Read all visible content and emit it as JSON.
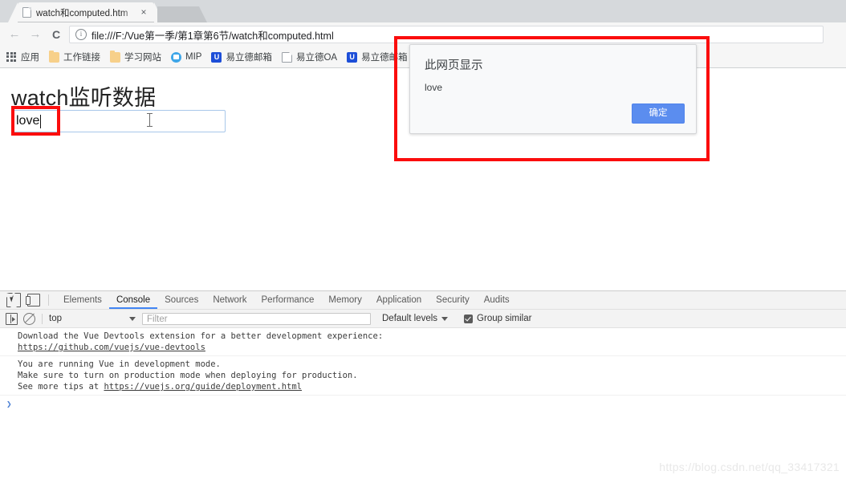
{
  "browser": {
    "tab": {
      "title": "watch和computed.htm",
      "close_label": "×",
      "favicon": "page-icon"
    },
    "nav": {
      "back": "←",
      "forward": "→",
      "reload": "C"
    },
    "omnibox": {
      "info_icon": "ⓘ",
      "url": "file:///F:/Vue第一季/第1章第6节/watch和computed.html"
    },
    "bookmarks": [
      {
        "label": "应用",
        "icon": "apps-grid-icon"
      },
      {
        "label": "工作链接",
        "icon": "folder-icon"
      },
      {
        "label": "学习网站",
        "icon": "folder-icon"
      },
      {
        "label": "MIP",
        "icon": "mip-icon"
      },
      {
        "label": "易立德邮箱",
        "icon": "u-badge-icon"
      },
      {
        "label": "易立德OA",
        "icon": "page-icon"
      },
      {
        "label": "易立德邮箱",
        "icon": "u-badge-icon"
      }
    ]
  },
  "page": {
    "heading": "watch监听数据",
    "input": {
      "value": "love",
      "placeholder": ""
    }
  },
  "dialog": {
    "title": "此网页显示",
    "message": "love",
    "ok_label": "确定",
    "accent_color": "#5b8def"
  },
  "annotations": {
    "color": "#fb0d0d"
  },
  "devtools": {
    "icons": {
      "inspect": "inspect-element-icon",
      "device": "device-toolbar-icon"
    },
    "tabs": [
      {
        "label": "Elements",
        "active": false
      },
      {
        "label": "Console",
        "active": true
      },
      {
        "label": "Sources",
        "active": false
      },
      {
        "label": "Network",
        "active": false
      },
      {
        "label": "Performance",
        "active": false
      },
      {
        "label": "Memory",
        "active": false
      },
      {
        "label": "Application",
        "active": false
      },
      {
        "label": "Security",
        "active": false
      },
      {
        "label": "Audits",
        "active": false
      }
    ],
    "filterbar": {
      "sidebar_icon": "console-sidebar-icon",
      "clear_icon": "clear-console-icon",
      "context": "top",
      "filter_placeholder": "Filter",
      "levels": "Default levels",
      "group_similar": "Group similar",
      "group_similar_checked": true
    },
    "console_messages": [
      {
        "lines": [
          {
            "text": "Download the Vue Devtools extension for a better development experience:",
            "link": false
          },
          {
            "text": "https://github.com/vuejs/vue-devtools",
            "link": true
          }
        ]
      },
      {
        "lines": [
          {
            "text": "You are running Vue in development mode.",
            "link": false
          },
          {
            "text": "Make sure to turn on production mode when deploying for production.",
            "link": false
          },
          {
            "text": "See more tips at ",
            "link": false,
            "suffix_link": "https://vuejs.org/guide/deployment.html"
          }
        ]
      }
    ],
    "prompt_symbol": "❯"
  },
  "watermark": "https://blog.csdn.net/qq_33417321"
}
